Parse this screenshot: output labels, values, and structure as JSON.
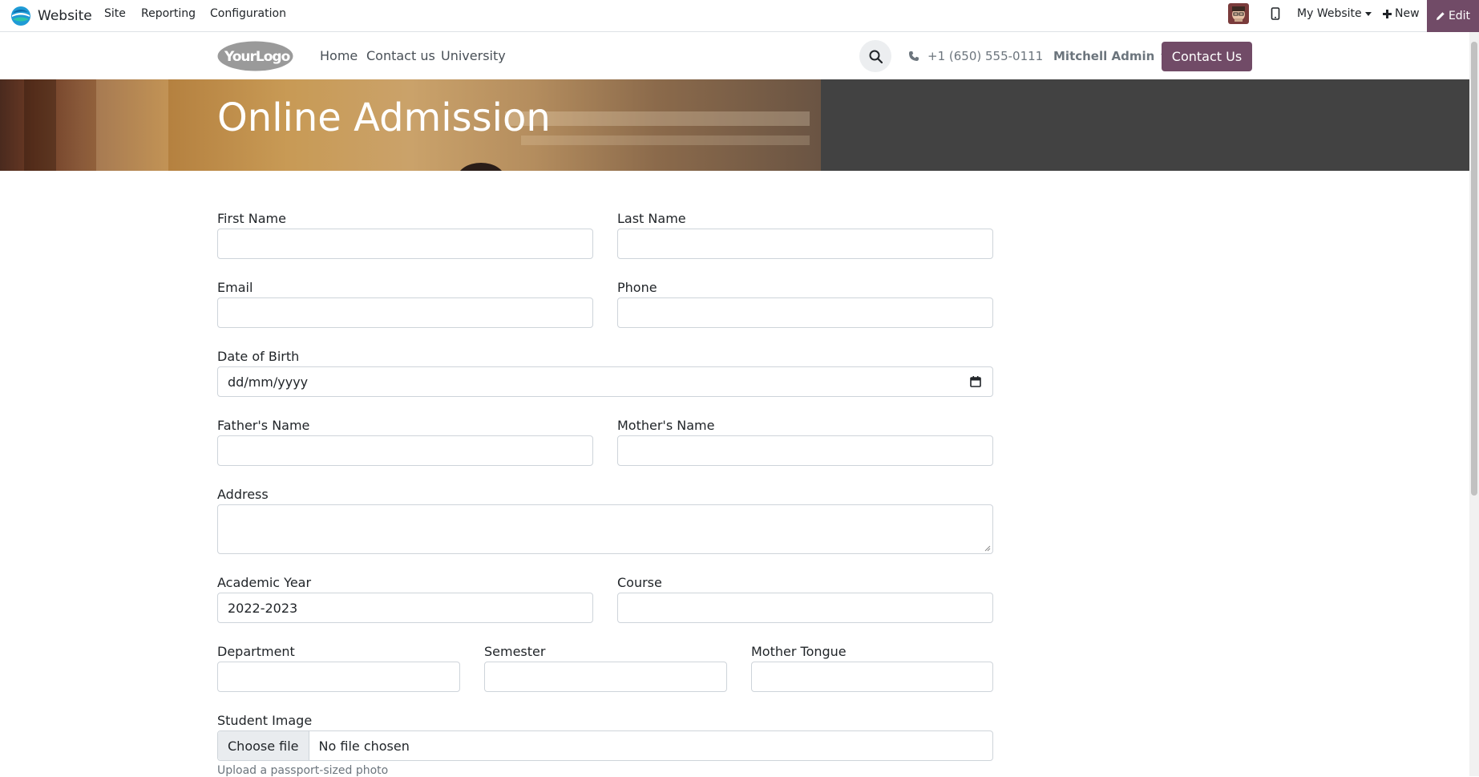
{
  "admin_bar": {
    "app_name": "Website",
    "menu": [
      "Site",
      "Reporting",
      "Configuration"
    ],
    "website_selector": "My Website",
    "new_label": "New",
    "edit_label": "Edit"
  },
  "site_header": {
    "logo_text": "YourLogo",
    "nav": [
      "Home",
      "Contact us",
      "University"
    ],
    "phone": "+1 (650) 555-0111",
    "user": "Mitchell Admin",
    "cta": "Contact Us"
  },
  "banner": {
    "title": "Online Admission"
  },
  "form": {
    "first_name": {
      "label": "First Name",
      "value": ""
    },
    "last_name": {
      "label": "Last Name",
      "value": ""
    },
    "email": {
      "label": "Email",
      "value": ""
    },
    "phone": {
      "label": "Phone",
      "value": ""
    },
    "dob": {
      "label": "Date of Birth",
      "value": "dd/mm/yyyy"
    },
    "father_name": {
      "label": "Father's Name",
      "value": ""
    },
    "mother_name": {
      "label": "Mother's Name",
      "value": ""
    },
    "address": {
      "label": "Address",
      "value": ""
    },
    "academic_year": {
      "label": "Academic Year",
      "value": "2022-2023"
    },
    "course": {
      "label": "Course",
      "value": ""
    },
    "department": {
      "label": "Department",
      "value": ""
    },
    "semester": {
      "label": "Semester",
      "value": ""
    },
    "mother_tongue": {
      "label": "Mother Tongue",
      "value": ""
    },
    "student_image": {
      "label": "Student Image",
      "button": "Choose file",
      "file_status": "No file chosen",
      "help": "Upload a passport-sized photo"
    }
  },
  "colors": {
    "brand": "#714b67",
    "banner_dark": "#424242",
    "input_border": "#ced4da"
  },
  "icons": [
    "odoo-website-icon",
    "avatar",
    "mobile-icon",
    "plus-icon",
    "pencil-icon",
    "search-icon",
    "phone-icon",
    "calendar-icon"
  ]
}
